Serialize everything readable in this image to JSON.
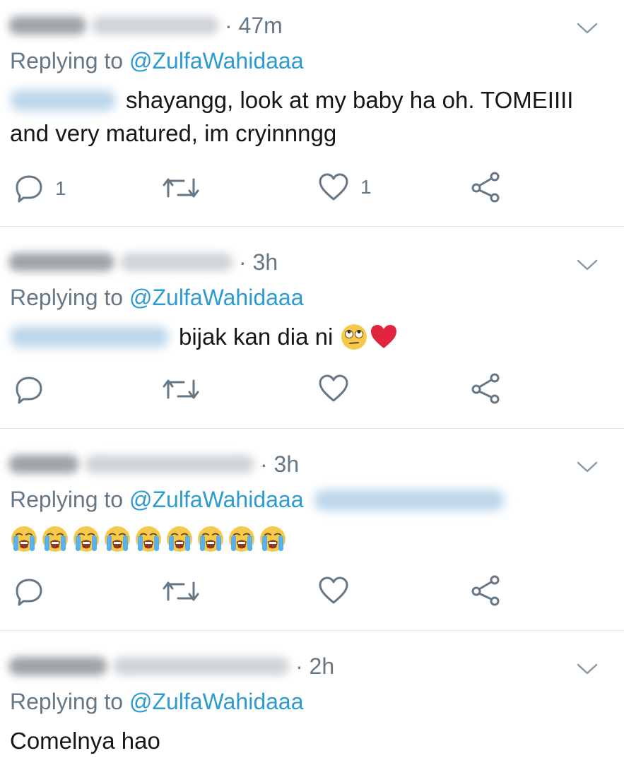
{
  "colors": {
    "accent": "#2b9bd0",
    "muted": "#657786",
    "heart": "#e0243d",
    "divider": "#dfe3e6"
  },
  "tweets": [
    {
      "time": "· 47m",
      "replying_prefix": "Replying to ",
      "handle": "@ZulfaWahidaaa",
      "text_line1": "shayangg, look at my baby ha oh. TOMEIIII",
      "text_line2": "and very matured, im cryinnngg",
      "reply_count": "1",
      "like_count": "1"
    },
    {
      "time": "· 3h",
      "replying_prefix": "Replying to ",
      "handle": "@ZulfaWahidaaa",
      "text_line1": "bijak kan dia ni",
      "emojis": [
        "face-with-rolling-eyes",
        "red-heart"
      ]
    },
    {
      "time": "· 3h",
      "replying_prefix": "Replying to ",
      "handle": "@ZulfaWahidaaa",
      "emojis": [
        "loudly-crying-face",
        "loudly-crying-face",
        "loudly-crying-face",
        "loudly-crying-face",
        "loudly-crying-face",
        "loudly-crying-face",
        "loudly-crying-face",
        "loudly-crying-face",
        "loudly-crying-face"
      ]
    },
    {
      "time": "· 2h",
      "replying_prefix": "Replying to ",
      "handle": "@ZulfaWahidaaa",
      "text_line1": "Comelnya hao"
    }
  ]
}
